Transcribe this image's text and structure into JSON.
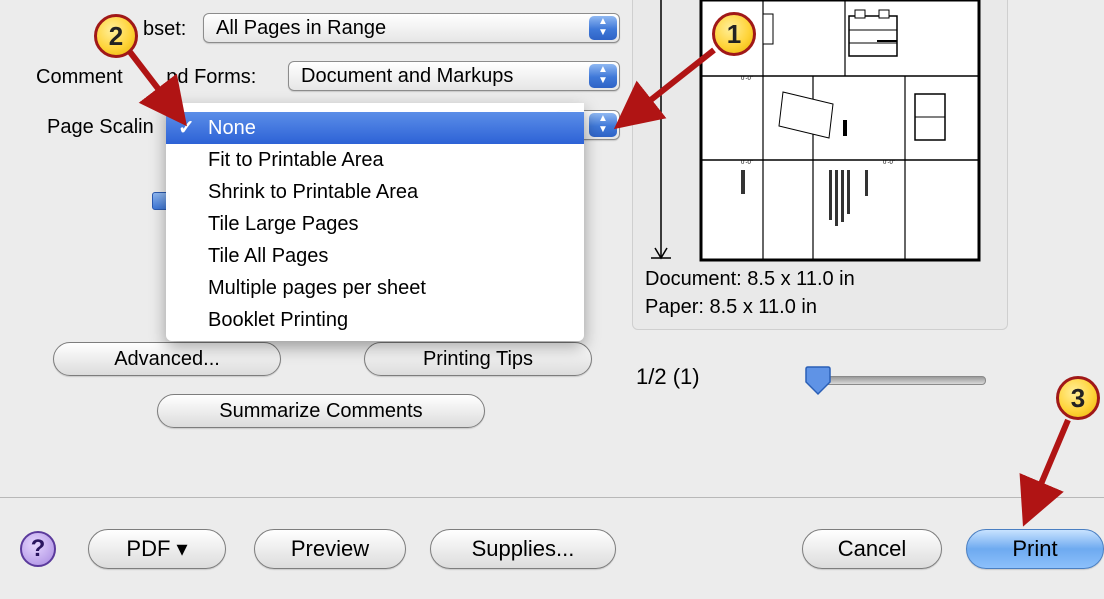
{
  "options": {
    "subset_label_visible": "bset:",
    "subset_value": "All Pages in Range",
    "comments_label_left": "Comment",
    "comments_label_right": "nd Forms:",
    "comments_value": "Document and Markups",
    "page_scaling_label": "Page Scalin"
  },
  "scaling_menu": {
    "items": [
      {
        "label": "None",
        "selected": true
      },
      {
        "label": "Fit to Printable Area"
      },
      {
        "label": "Shrink to Printable Area"
      },
      {
        "label": "Tile Large Pages"
      },
      {
        "label": "Tile All Pages"
      },
      {
        "label": "Multiple pages per sheet"
      },
      {
        "label": "Booklet Printing"
      }
    ],
    "checkmark": "✓"
  },
  "buttons": {
    "advanced": "Advanced...",
    "printing_tips": "Printing Tips",
    "summarize": "Summarize Comments",
    "pdf": "PDF ▾",
    "preview": "Preview",
    "supplies": "Supplies...",
    "cancel": "Cancel",
    "print": "Print",
    "help": "?"
  },
  "preview_pane": {
    "document_size": "Document: 8.5 x 11.0 in",
    "paper_size": "Paper: 8.5 x 11.0 in",
    "page_indicator": "1/2 (1)",
    "slider_position": 0.0
  },
  "callouts": [
    "1",
    "2",
    "3"
  ],
  "colors": {
    "selection": "#2d62d6",
    "callout_fill": "#ffd43b",
    "callout_border": "#a01818",
    "arrow": "#b01414"
  }
}
